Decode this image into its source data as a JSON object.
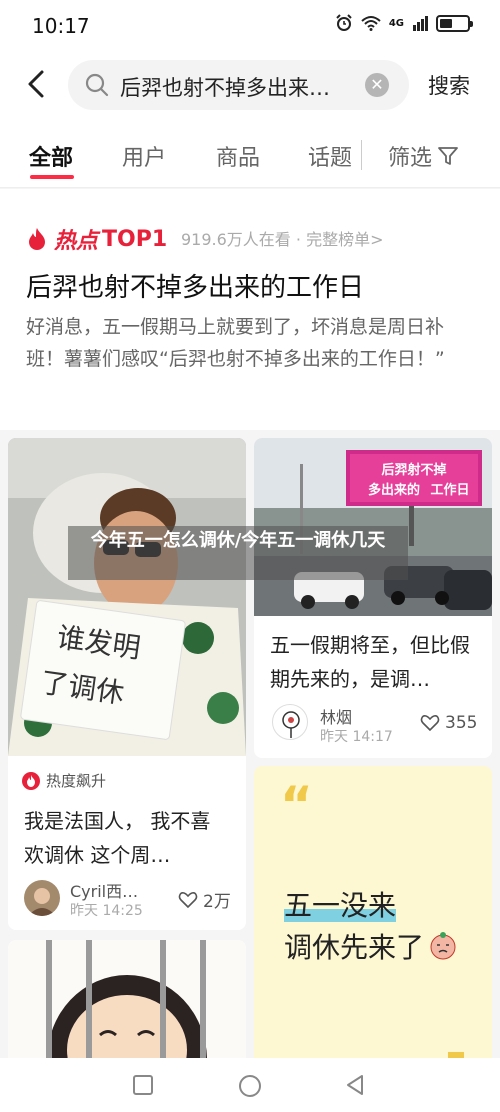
{
  "status": {
    "time": "10:17",
    "icons": [
      "alarm-icon",
      "wifi-icon",
      "4g-signal-icon",
      "battery-icon"
    ],
    "network": "4G"
  },
  "search": {
    "query": "后羿也射不掉多出来…",
    "submit_label": "搜索"
  },
  "tabs": [
    {
      "label": "全部",
      "active": true
    },
    {
      "label": "用户"
    },
    {
      "label": "商品"
    },
    {
      "label": "话题"
    }
  ],
  "filter_label": "筛选",
  "hot": {
    "badge": "热点",
    "rank": "TOP1",
    "meta": "919.6万人在看 · 完整榜单>",
    "title": "后羿也射不掉多出来的工作日",
    "desc": "好消息，五一假期马上就要到了，坏消息是周日补班！薯薯们感叹“后羿也射不掉多出来的工作日！”"
  },
  "overlay_headline": "今年五一怎么调休/今年五一调休几天",
  "cards": {
    "left1": {
      "sign_text": [
        "谁发明",
        "了调休"
      ],
      "tag": "热度飙升",
      "title": "我是法国人， 我不喜欢调休 这个周…",
      "author": "Cyril西…",
      "time": "昨天 14:25",
      "likes": "2万"
    },
    "right1": {
      "billboard": [
        "后羿射不掉",
        "多出来的",
        "工作日"
      ],
      "title": "五一假期将至，但比假期先来的，是调…",
      "author": "林烟",
      "time": "昨天 14:17",
      "likes": "355"
    },
    "right2": {
      "quote_mark": "“",
      "line1": "五一没来",
      "line2": "调休先来了"
    }
  },
  "colors": {
    "accent": "#ff2b45",
    "hot_red": "#e8213a",
    "note_bg": "#fdf7d2"
  }
}
